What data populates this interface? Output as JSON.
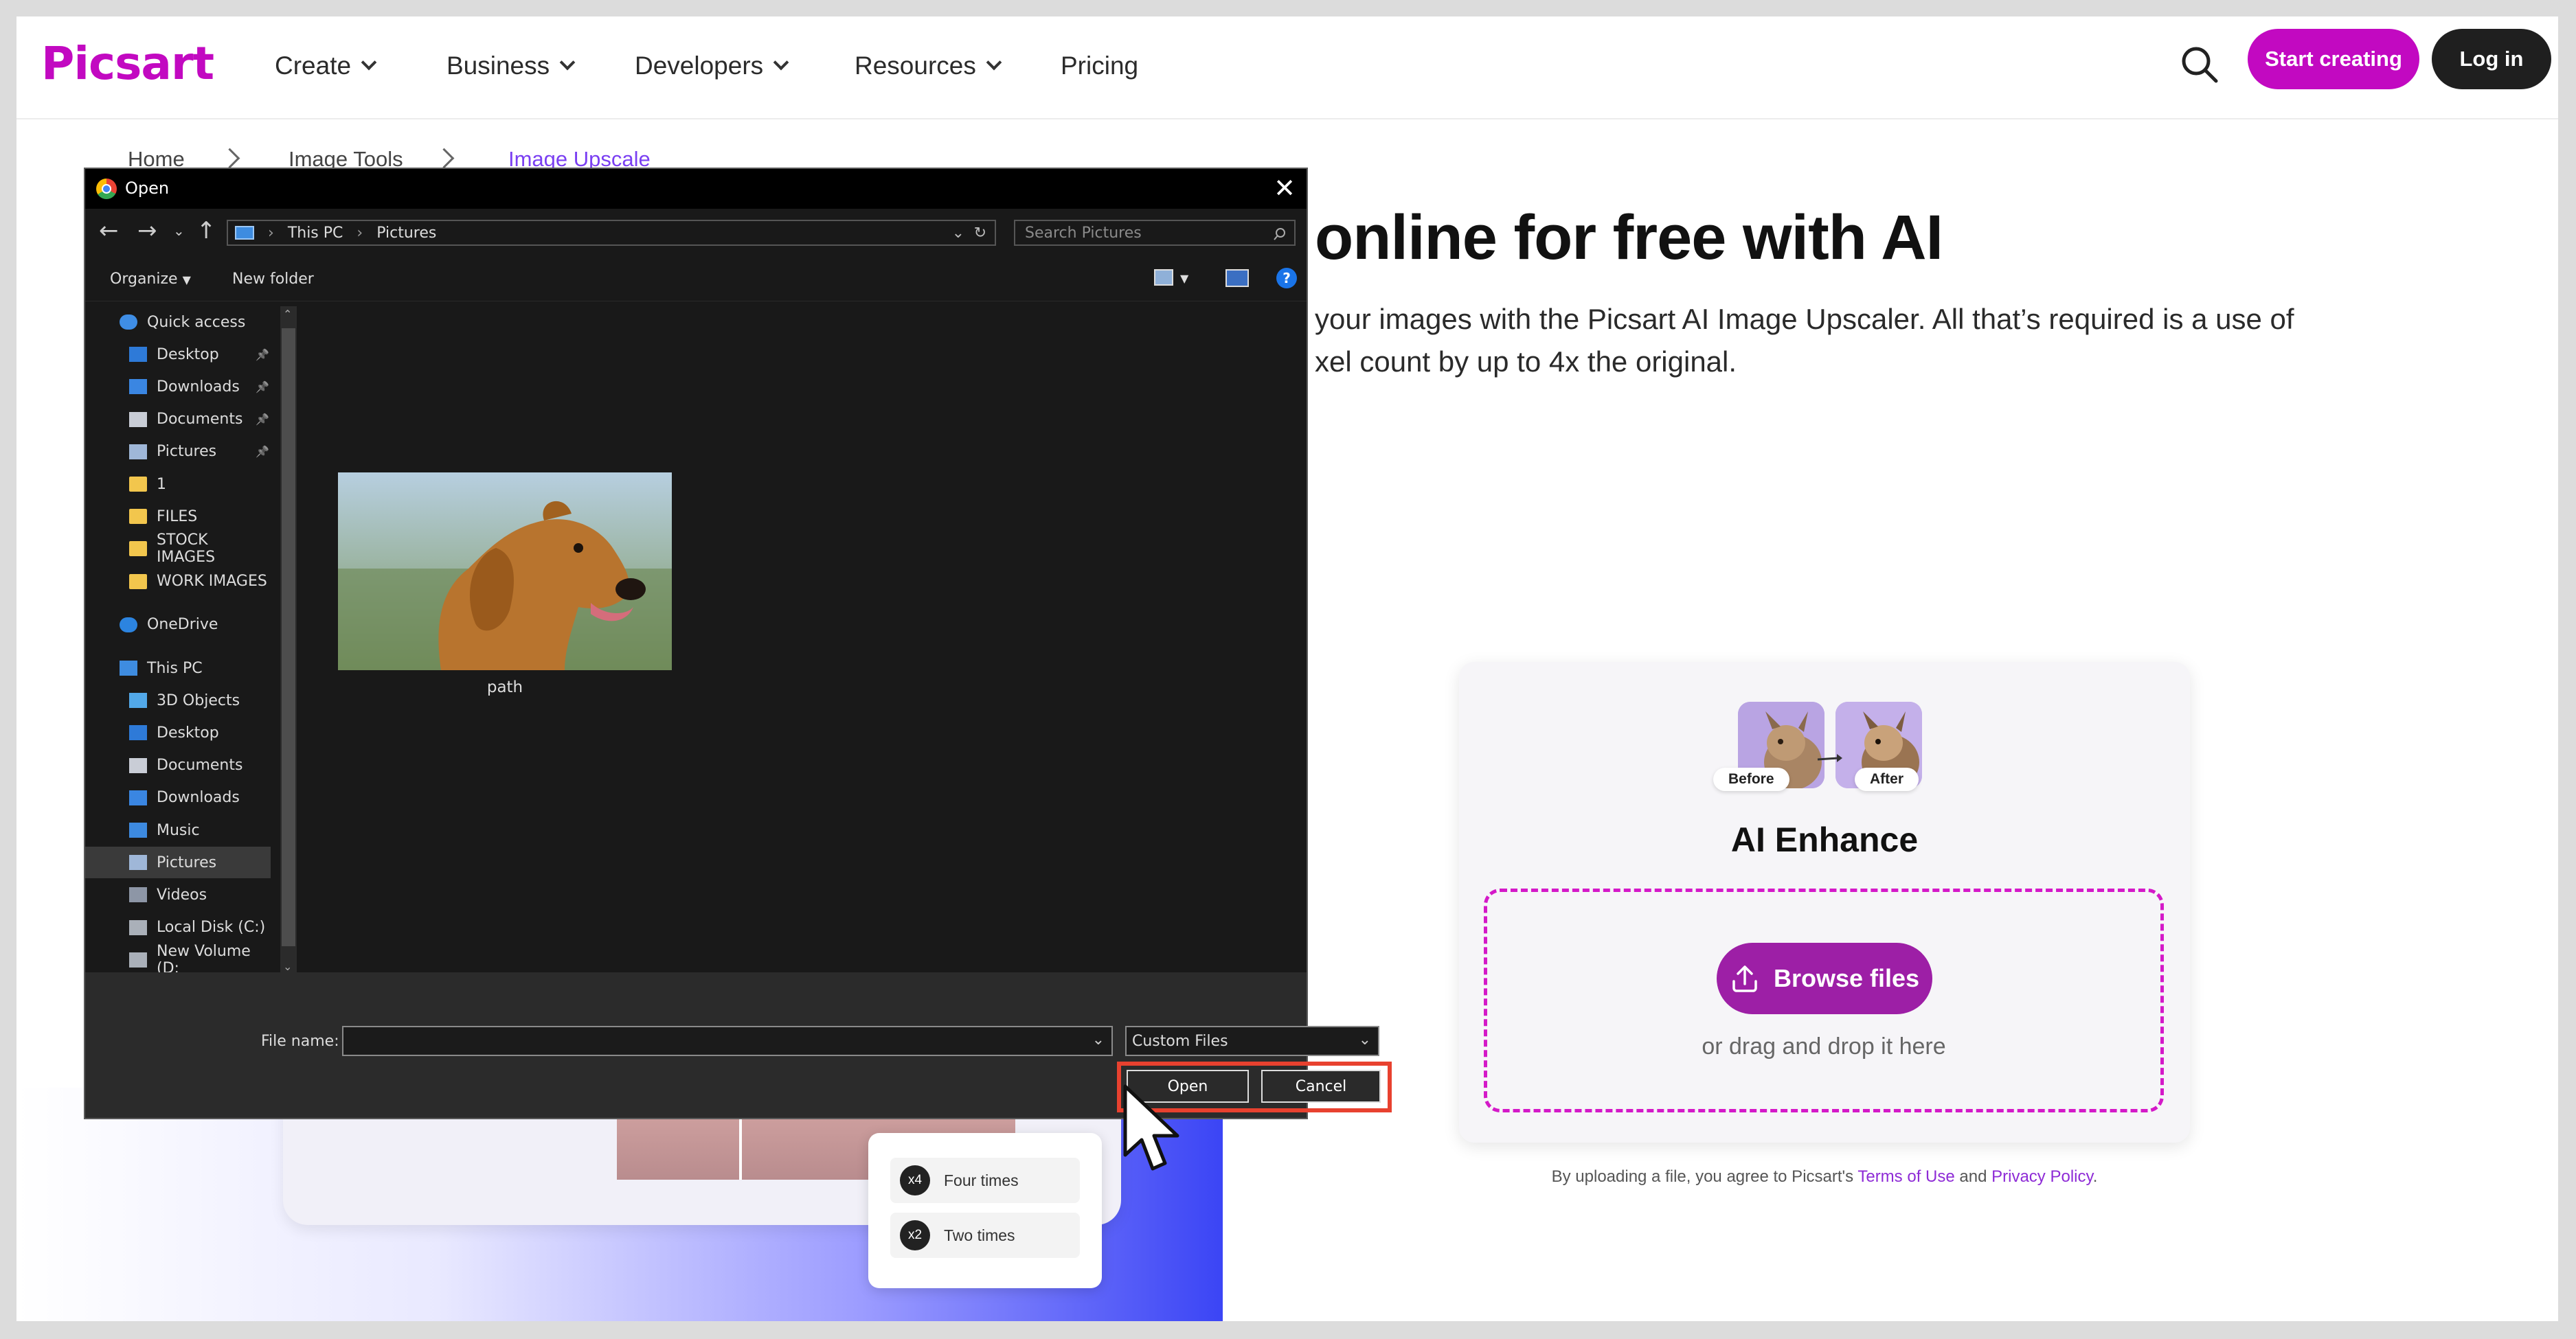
{
  "brand": {
    "logo_text": "Picsart",
    "accent": "#c209c1"
  },
  "nav": {
    "items": [
      {
        "label": "Create",
        "has_dropdown": true
      },
      {
        "label": "Business",
        "has_dropdown": true
      },
      {
        "label": "Developers",
        "has_dropdown": true
      },
      {
        "label": "Resources",
        "has_dropdown": true
      },
      {
        "label": "Pricing",
        "has_dropdown": false
      }
    ],
    "search_icon": "search-icon",
    "start_label": "Start creating",
    "login_label": "Log in"
  },
  "breadcrumb": [
    "Home",
    "Image Tools",
    "Image Upscale"
  ],
  "hero": {
    "title": "online for free with AI",
    "line1": "your images with the Picsart AI Image Upscaler. All that’s required is a use of",
    "line2": "xel count by up to 4x the original."
  },
  "upload": {
    "before_label": "Before",
    "after_label": "After",
    "title": "AI Enhance",
    "browse_label": "Browse files",
    "drag_text": "or drag and drop it here",
    "terms_prefix": "By uploading a file, you agree to Picsart's ",
    "terms_link": "Terms of Use",
    "terms_and": " and ",
    "privacy_link": "Privacy Policy",
    "terms_suffix": "."
  },
  "promo": {
    "options": [
      {
        "badge": "x4",
        "label": "Four times"
      },
      {
        "badge": "x2",
        "label": "Two times"
      }
    ]
  },
  "dialog": {
    "title": "Open",
    "close_glyph": "✕",
    "path": [
      "This PC",
      "Pictures"
    ],
    "search_placeholder": "Search Pictures",
    "organize_label": "Organize",
    "new_folder_label": "New folder",
    "sidebar": [
      {
        "label": "Quick access",
        "icon": "star-icon",
        "level": 0
      },
      {
        "label": "Desktop",
        "icon": "desktop-icon",
        "level": 1,
        "pinned": true
      },
      {
        "label": "Downloads",
        "icon": "download-icon",
        "level": 1,
        "pinned": true
      },
      {
        "label": "Documents",
        "icon": "document-icon",
        "level": 1,
        "pinned": true
      },
      {
        "label": "Pictures",
        "icon": "pictures-icon",
        "level": 1,
        "pinned": true
      },
      {
        "label": "1",
        "icon": "folder-icon",
        "level": 1
      },
      {
        "label": "FILES",
        "icon": "folder-icon",
        "level": 1
      },
      {
        "label": "STOCK IMAGES",
        "icon": "folder-icon",
        "level": 1
      },
      {
        "label": "WORK IMAGES",
        "icon": "folder-icon",
        "level": 1
      },
      {
        "label": "OneDrive",
        "icon": "cloud-icon",
        "level": 0
      },
      {
        "label": "This PC",
        "icon": "computer-icon",
        "level": 0
      },
      {
        "label": "3D Objects",
        "icon": "cube-icon",
        "level": 1
      },
      {
        "label": "Desktop",
        "icon": "desktop-icon",
        "level": 1
      },
      {
        "label": "Documents",
        "icon": "document-icon",
        "level": 1
      },
      {
        "label": "Downloads",
        "icon": "download-icon",
        "level": 1
      },
      {
        "label": "Music",
        "icon": "music-icon",
        "level": 1
      },
      {
        "label": "Pictures",
        "icon": "pictures-icon",
        "level": 1,
        "selected": true
      },
      {
        "label": "Videos",
        "icon": "video-icon",
        "level": 1
      },
      {
        "label": "Local Disk (C:)",
        "icon": "disk-icon",
        "level": 1
      },
      {
        "label": "New Volume (D:",
        "icon": "drive-icon",
        "level": 1
      }
    ],
    "file": {
      "name": "path"
    },
    "filename_label": "File name:",
    "filename_value": "",
    "filetype": "Custom Files",
    "open_label": "Open",
    "cancel_label": "Cancel",
    "highlight_color": "#e8412f"
  }
}
